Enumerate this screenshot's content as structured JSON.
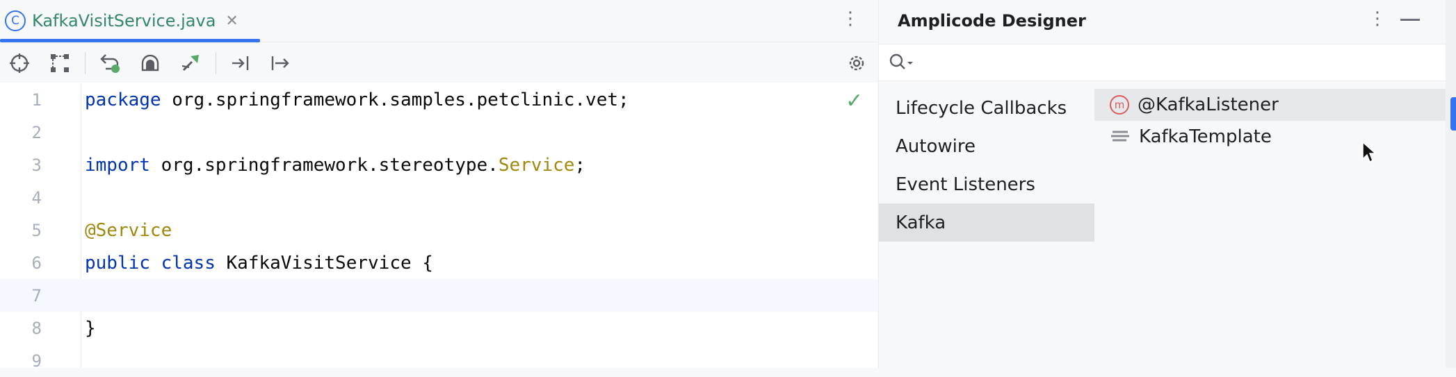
{
  "editor": {
    "tab": {
      "title": "KafkaVisitService.java",
      "icon": "class-c-icon",
      "close": "✕"
    },
    "menu": "⋮",
    "code_lines": [
      {
        "n": "1",
        "tokens": [
          {
            "t": "package",
            "c": "kw"
          },
          {
            "t": " org.springframework.samples.petclinic.vet;",
            "c": ""
          }
        ]
      },
      {
        "n": "2",
        "tokens": []
      },
      {
        "n": "3",
        "tokens": [
          {
            "t": "import",
            "c": "kw"
          },
          {
            "t": " org.springframework.stereotype.",
            "c": ""
          },
          {
            "t": "Service",
            "c": "typ"
          },
          {
            "t": ";",
            "c": ""
          }
        ]
      },
      {
        "n": "4",
        "tokens": []
      },
      {
        "n": "5",
        "tokens": [
          {
            "t": "@Service",
            "c": "anno"
          }
        ]
      },
      {
        "n": "6",
        "tokens": [
          {
            "t": "public",
            "c": "kw"
          },
          {
            "t": " ",
            "c": ""
          },
          {
            "t": "class",
            "c": "kw"
          },
          {
            "t": " KafkaVisitService {",
            "c": ""
          }
        ]
      },
      {
        "n": "7",
        "tokens": [],
        "current": true
      },
      {
        "n": "8",
        "tokens": [
          {
            "t": "}",
            "c": ""
          }
        ]
      },
      {
        "n": "9",
        "tokens": []
      }
    ],
    "status_mark": "✓"
  },
  "designer": {
    "title": "Amplicode Designer",
    "menu": "⋮",
    "search": {
      "placeholder": "",
      "value": ""
    },
    "categories": [
      {
        "label": "Lifecycle Callbacks",
        "selected": false
      },
      {
        "label": "Autowire",
        "selected": false
      },
      {
        "label": "Event Listeners",
        "selected": false
      },
      {
        "label": "Kafka",
        "selected": true
      }
    ],
    "items": [
      {
        "label": "@KafkaListener",
        "icon": "m-icon",
        "selected": true
      },
      {
        "label": "KafkaTemplate",
        "icon": "template-icon",
        "selected": false
      }
    ]
  },
  "colors": {
    "accent": "#3574f0",
    "keyword": "#0033b3",
    "annotation": "#9e880d",
    "tab_text": "#33876a",
    "check": "#59a869"
  }
}
